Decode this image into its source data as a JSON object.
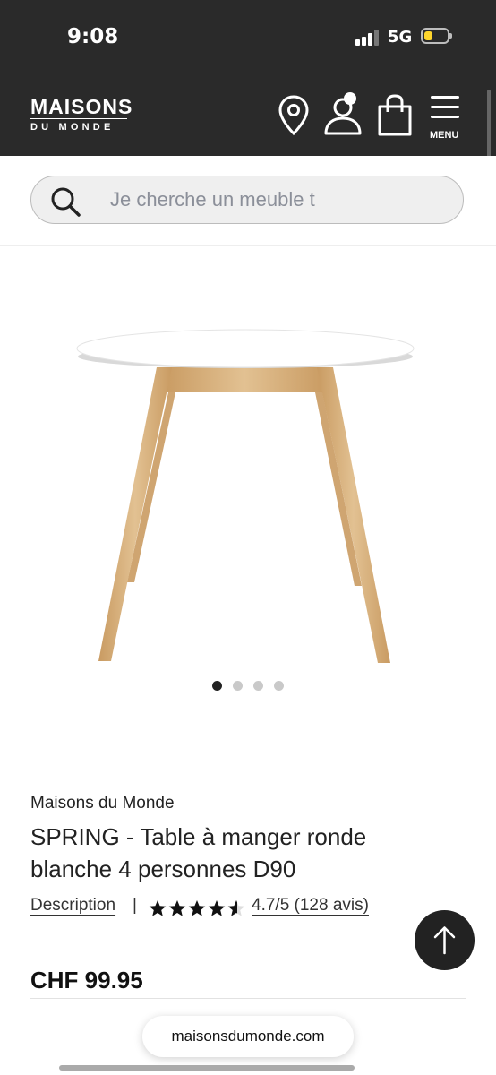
{
  "status_bar": {
    "time": "9:08",
    "network": "5G"
  },
  "header": {
    "logo_main": "MAISONS",
    "logo_sub": "DU MONDE",
    "menu_label": "MENU"
  },
  "search": {
    "placeholder": "Je cherche un meuble t"
  },
  "gallery": {
    "image_count": 4,
    "active_index": 0
  },
  "product": {
    "brand": "Maisons du Monde",
    "title": "SPRING - Table à manger ronde blanche 4 personnes D90",
    "description_link": "Description",
    "separator": "|",
    "rating_value": 4.7,
    "rating_text": "4.7/5 (128 avis)",
    "price": "CHF 99.95"
  },
  "browser": {
    "url": "maisonsdumonde.com"
  },
  "colors": {
    "dark": "#2a2a2a",
    "wood": "#d8b383",
    "accent_battery": "#ffd62c"
  }
}
